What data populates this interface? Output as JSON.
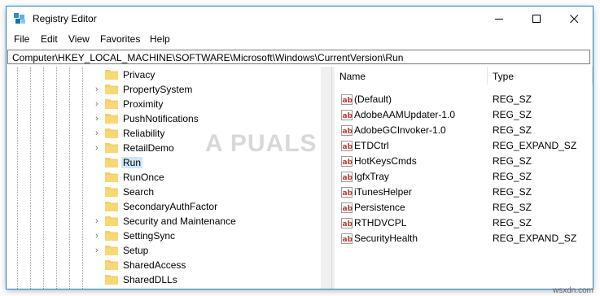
{
  "window": {
    "title": "Registry Editor",
    "controls": {
      "minimize": "—",
      "maximize": "☐",
      "close": "✕"
    }
  },
  "menu": [
    "File",
    "Edit",
    "View",
    "Favorites",
    "Help"
  ],
  "address": "Computer\\HKEY_LOCAL_MACHINE\\SOFTWARE\\Microsoft\\Windows\\CurrentVersion\\Run",
  "tree": {
    "items": [
      {
        "label": "Privacy",
        "expandable": false,
        "selected": false
      },
      {
        "label": "PropertySystem",
        "expandable": true,
        "selected": false
      },
      {
        "label": "Proximity",
        "expandable": true,
        "selected": false
      },
      {
        "label": "PushNotifications",
        "expandable": true,
        "selected": false
      },
      {
        "label": "Reliability",
        "expandable": true,
        "selected": false
      },
      {
        "label": "RetailDemo",
        "expandable": true,
        "selected": false
      },
      {
        "label": "Run",
        "expandable": false,
        "selected": true
      },
      {
        "label": "RunOnce",
        "expandable": false,
        "selected": false
      },
      {
        "label": "Search",
        "expandable": false,
        "selected": false
      },
      {
        "label": "SecondaryAuthFactor",
        "expandable": false,
        "selected": false
      },
      {
        "label": "Security and Maintenance",
        "expandable": true,
        "selected": false
      },
      {
        "label": "SettingSync",
        "expandable": true,
        "selected": false
      },
      {
        "label": "Setup",
        "expandable": true,
        "selected": false
      },
      {
        "label": "SharedAccess",
        "expandable": false,
        "selected": false
      },
      {
        "label": "SharedDLLs",
        "expandable": false,
        "selected": false
      }
    ]
  },
  "list": {
    "columns": {
      "name": "Name",
      "type": "Type"
    },
    "rows": [
      {
        "name": "(Default)",
        "type": "REG_SZ"
      },
      {
        "name": "AdobeAAMUpdater-1.0",
        "type": "REG_SZ"
      },
      {
        "name": "AdobeGCInvoker-1.0",
        "type": "REG_SZ"
      },
      {
        "name": "ETDCtrl",
        "type": "REG_EXPAND_SZ"
      },
      {
        "name": "HotKeysCmds",
        "type": "REG_SZ"
      },
      {
        "name": "IgfxTray",
        "type": "REG_SZ"
      },
      {
        "name": "iTunesHelper",
        "type": "REG_SZ"
      },
      {
        "name": "Persistence",
        "type": "REG_SZ"
      },
      {
        "name": "RTHDVCPL",
        "type": "REG_SZ"
      },
      {
        "name": "SecurityHealth",
        "type": "REG_EXPAND_SZ"
      }
    ],
    "value_icon": "ab"
  },
  "watermark": "A PUALS",
  "site_credit": "wsxdn.com",
  "colors": {
    "accent": "#1d84d0",
    "selection": "#cce8ff",
    "folder": "#f4cf6b",
    "value_icon": "#c0392b"
  }
}
